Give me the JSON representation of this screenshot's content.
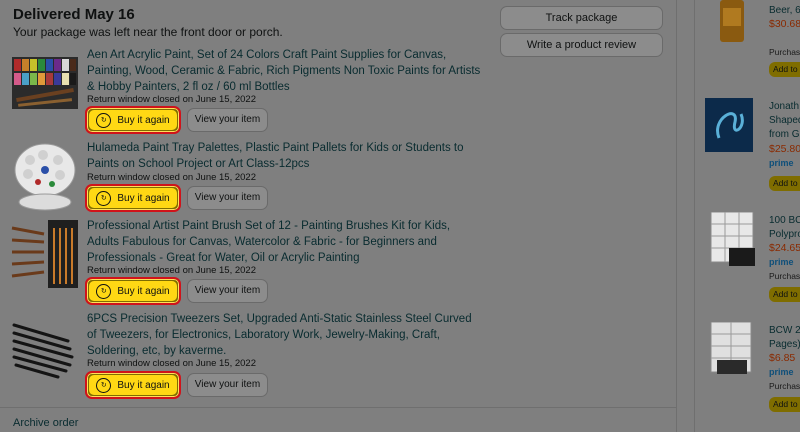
{
  "order": {
    "delivery_title": "Delivered May 16",
    "delivery_subtitle": "Your package was left near the front door or porch.",
    "track_label": "Track package",
    "review_label": "Write a product review",
    "archive_label": "Archive order",
    "items": [
      {
        "title": "Aen Art Acrylic Paint, Set of 24 Colors Craft Paint Supplies for Canvas, Painting, Wood, Ceramic & Fabric, Rich Pigments Non Toxic Paints for Artists & Hobby Painters, 2 fl oz / 60 ml Bottles",
        "return_note": "Return window closed on June 15, 2022",
        "buy_label": "Buy it again",
        "view_label": "View your item"
      },
      {
        "title": "Hulameda Paint Tray Palettes, Plastic Paint Pallets for Kids or Students to Paints on School Project or Art Class-12pcs",
        "return_note": "Return window closed on June 15, 2022",
        "buy_label": "Buy it again",
        "view_label": "View your item"
      },
      {
        "title": "Professional Artist Paint Brush Set of 12 - Painting Brushes Kit for Kids, Adults Fabulous for Canvas, Watercolor & Fabric - for Beginners and Professionals - Great for Water, Oil or Acrylic Painting",
        "return_note": "Return window closed on June 15, 2022",
        "buy_label": "Buy it again",
        "view_label": "View your item"
      },
      {
        "title": "6PCS Precision Tweezers Set, Upgraded Anti-Static Stainless Steel Curved of Tweezers, for Electronics, Laboratory Work, Jewelry-Making, Craft, Soldering, etc, by kaverme.",
        "return_note": "Return window closed on June 15, 2022",
        "buy_label": "Buy it again",
        "view_label": "View your item"
      }
    ]
  },
  "recommendations": [
    {
      "title_line1": "Beer, 6",
      "price": "$30.68",
      "sub": "Purchas",
      "add": "Add to"
    },
    {
      "title_line1": "Jonath",
      "title_line2": "Shaped",
      "title_line3": "from G",
      "price": "$25.80",
      "prime": "prime",
      "add": "Add to"
    },
    {
      "title_line1": "100 BC",
      "title_line2": "Polypro",
      "price": "$24.65",
      "prime": "prime",
      "sub": "Purchas",
      "add": "Add to"
    },
    {
      "title_line1": "BCW 2",
      "title_line2": "Pages)",
      "price": "$6.85",
      "prime": "prime",
      "sub": "Purchas",
      "add": "Add to"
    }
  ],
  "colors": {
    "buy_button": "#ffd814",
    "highlight_border": "#d0131a",
    "link": "#082b2f"
  }
}
